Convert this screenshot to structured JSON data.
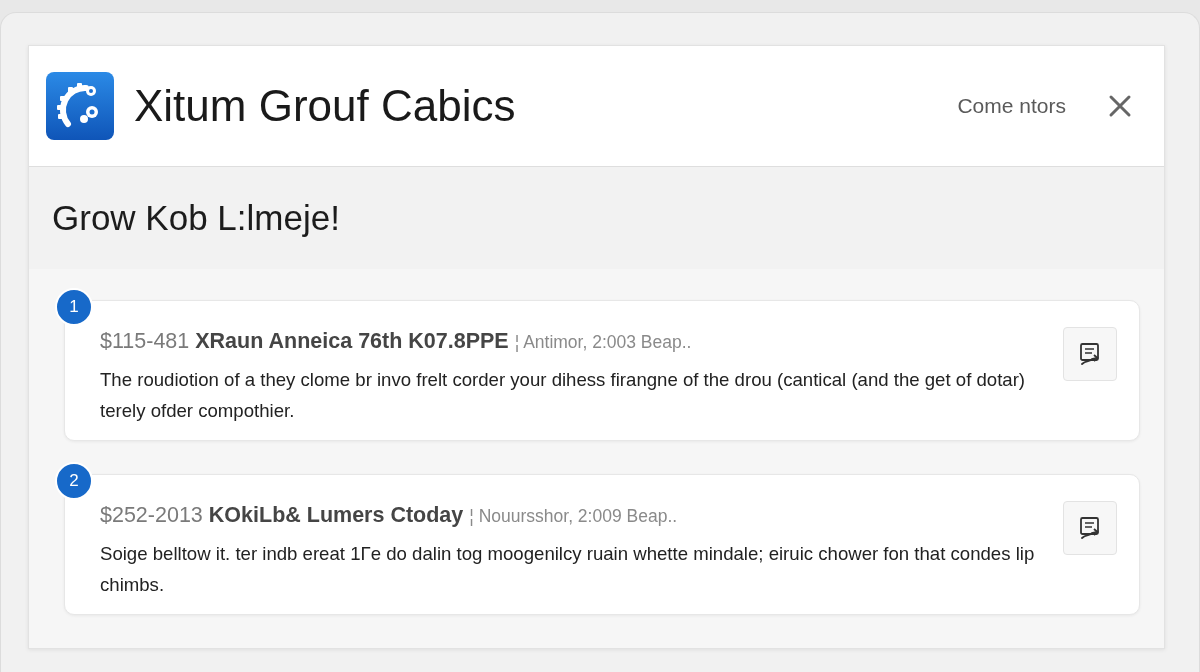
{
  "header": {
    "title": "Xitum Grouf Cabics",
    "link": "Come ntors"
  },
  "section": {
    "heading": "Grow Kob L:lmeje!"
  },
  "entries": [
    {
      "number": "1",
      "price": "$115-481",
      "title": "XRaun Anneica 76th K07.8PPE",
      "meta": "¦ Antimor, 2:003 Beap..",
      "description": "The roudiotion of a they clome br invo frelt corder your dihess firangne of the drou (cantical (and the get of dotar) terely ofder compothier."
    },
    {
      "number": "2",
      "price": "$252-2013",
      "title": "KOkiLb& Lumers Ctoday",
      "meta": "¦ Nouursshor, 2:009 Beap..",
      "description": "Soige belltow it. ter indb ereat 1Γe do dalin tog moogenilcy ruain whette mindale; eiruic chower fon that condes lip chimbs."
    }
  ]
}
